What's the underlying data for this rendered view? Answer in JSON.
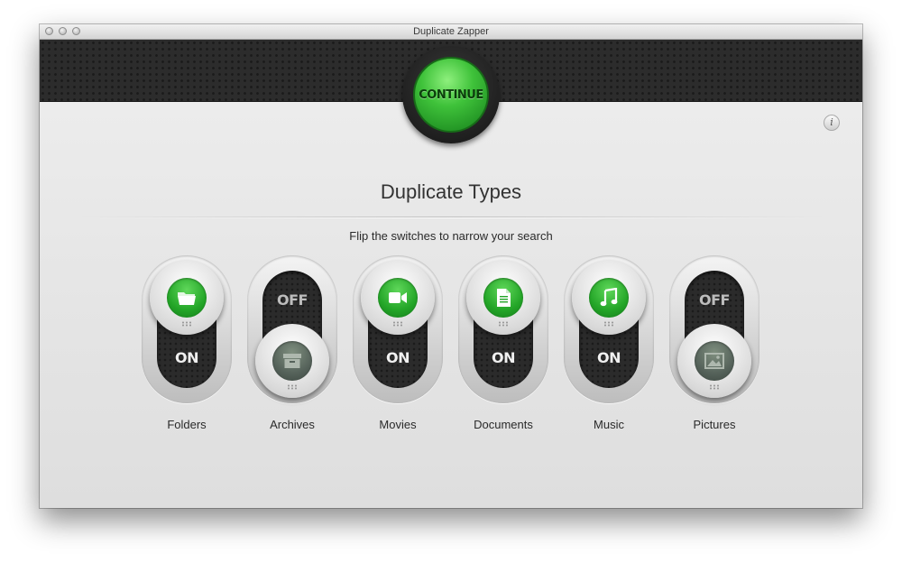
{
  "window": {
    "title": "Duplicate Zapper"
  },
  "header": {
    "continue_label": "CONTINUE"
  },
  "info": {
    "label": "i"
  },
  "main": {
    "title": "Duplicate Types",
    "subtitle": "Flip the switches to narrow your search"
  },
  "switches": [
    {
      "label": "Folders",
      "state": "ON",
      "icon": "folder-icon"
    },
    {
      "label": "Archives",
      "state": "OFF",
      "icon": "archive-box-icon"
    },
    {
      "label": "Movies",
      "state": "ON",
      "icon": "video-camera-icon"
    },
    {
      "label": "Documents",
      "state": "ON",
      "icon": "document-icon"
    },
    {
      "label": "Music",
      "state": "ON",
      "icon": "music-note-icon"
    },
    {
      "label": "Pictures",
      "state": "OFF",
      "icon": "picture-icon"
    }
  ],
  "colors": {
    "accent_green": "#2fb52f",
    "band_dark": "#2c2c2c"
  }
}
